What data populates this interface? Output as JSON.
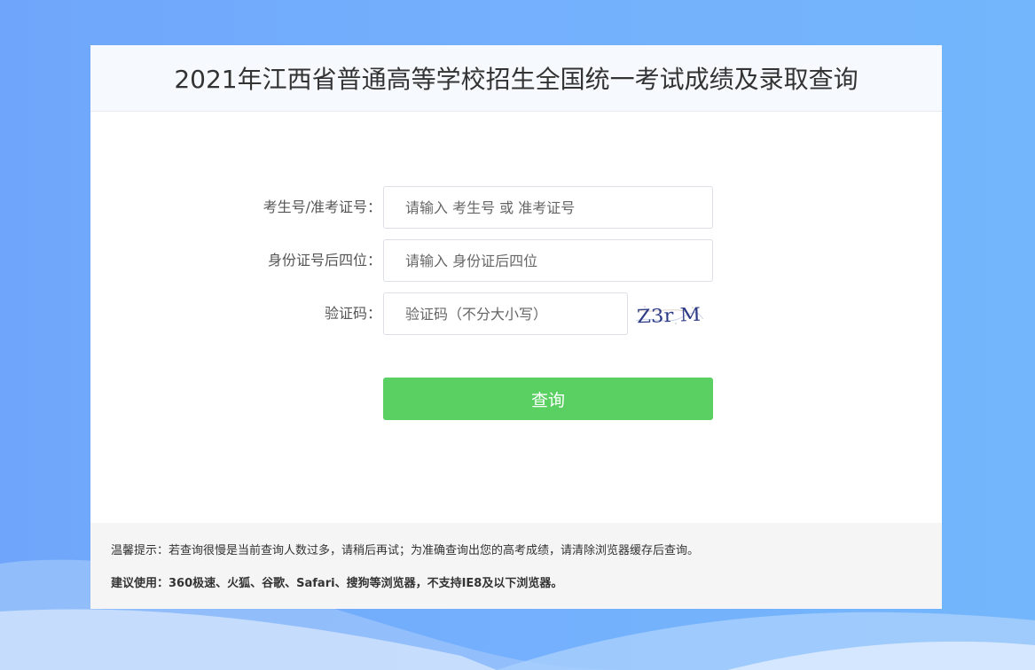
{
  "header": {
    "title": "2021年江西省普通高等学校招生全国统一考试成绩及录取查询"
  },
  "form": {
    "exam_id": {
      "label": "考生号/准考证号：",
      "placeholder": "请输入 考生号 或 准考证号",
      "value": ""
    },
    "id_last4": {
      "label": "身份证号后四位：",
      "placeholder": "请输入 身份证后四位",
      "value": ""
    },
    "captcha": {
      "label": "验证码：",
      "placeholder": "验证码（不分大小写）",
      "value": "",
      "image_text": "Z3r M"
    },
    "submit_label": "查询"
  },
  "footer": {
    "notice": "温馨提示：若查询很慢是当前查询人数过多，请稍后再试；为准确查询出您的高考成绩，请清除浏览器缓存后查询。",
    "advice": "建议使用：360极速、火狐、谷歌、Safari、搜狗等浏览器，不支持IE8及以下浏览器。"
  },
  "colors": {
    "background": "#74b0fd",
    "header_bg": "#f6f9fd",
    "button": "#5bd062",
    "footer_bg": "#f5f5f5"
  }
}
